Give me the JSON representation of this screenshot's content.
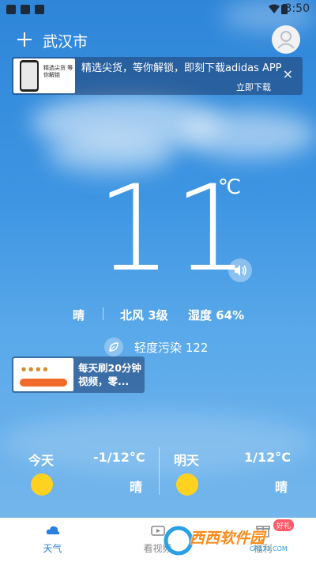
{
  "status_bar": {
    "time": "3:50"
  },
  "header": {
    "add_icon": "plus-icon",
    "city": "武汉市",
    "avatar_icon": "user-icon"
  },
  "top_ad": {
    "text": "精选尖货，等你解锁，即刻下载adidas APP",
    "cta": "立即下载",
    "close": "×",
    "image_caption": "精选尖货 等你解锁"
  },
  "current": {
    "temperature": "11",
    "unit": "℃",
    "condition": "晴",
    "wind": "北风 3级",
    "humidity": "湿度 64%",
    "air_quality": "轻度污染 122",
    "speaker_icon": "speaker-icon"
  },
  "mid_ad": {
    "text": "每天刷20分钟视频，零..."
  },
  "forecast": [
    {
      "day": "今天",
      "range": "-1/12°C",
      "icon": "sun-icon",
      "condition": "晴"
    },
    {
      "day": "明天",
      "range": "1/12°C",
      "icon": "sun-icon",
      "condition": "晴"
    }
  ],
  "tabs": [
    {
      "label": "天气",
      "icon": "cloud-icon",
      "active": true
    },
    {
      "label": "看视频",
      "icon": "video-icon",
      "active": false
    },
    {
      "label": "福利",
      "icon": "gift-icon",
      "active": false,
      "badge": "好礼"
    }
  ],
  "colors": {
    "accent": "#2a7ee0",
    "sun": "#ffd21f",
    "badge": "#ff5a6a"
  },
  "watermark": {
    "text": "西西软件园",
    "sub": "CR173.COM"
  }
}
